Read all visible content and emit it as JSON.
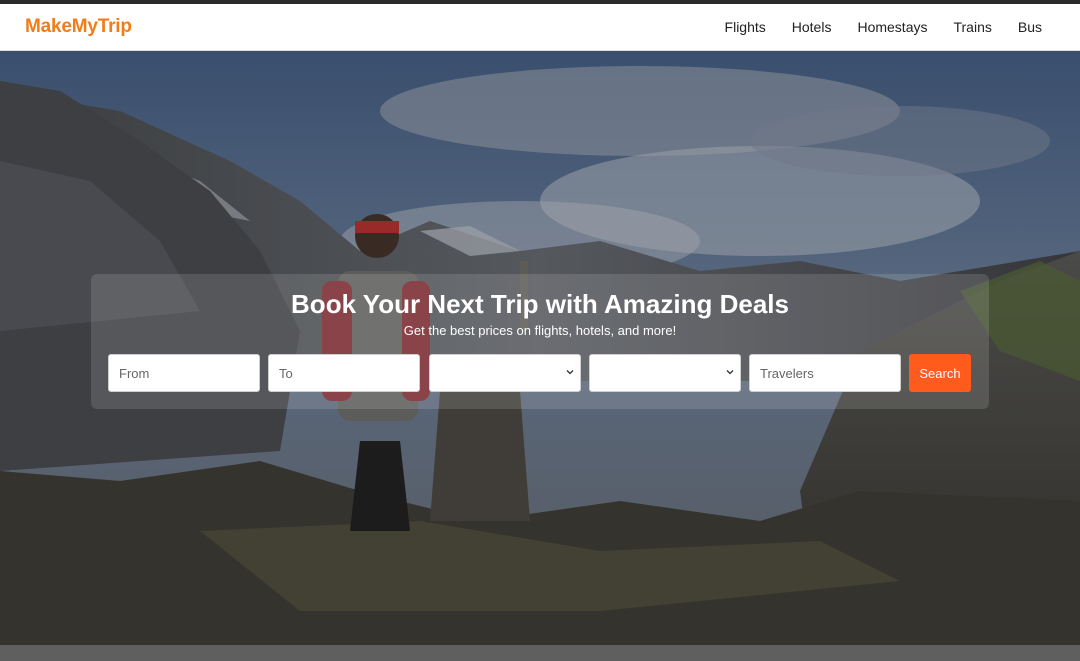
{
  "brand": {
    "name": "MakeMyTrip",
    "color": "#f07d1a"
  },
  "nav": {
    "links": [
      "Flights",
      "Hotels",
      "Homestays",
      "Trains",
      "Bus"
    ]
  },
  "hero": {
    "title": "Book Your Next Trip with Amazing Deals",
    "subtitle": "Get the best prices on flights, hotels, and more!",
    "background": "mountain-hiker-photo"
  },
  "search": {
    "from_placeholder": "From",
    "to_placeholder": "To",
    "select_one_value": "",
    "select_two_value": "",
    "travelers_placeholder": "Travelers",
    "button_label": "Search",
    "button_color": "#ff5b1c"
  }
}
